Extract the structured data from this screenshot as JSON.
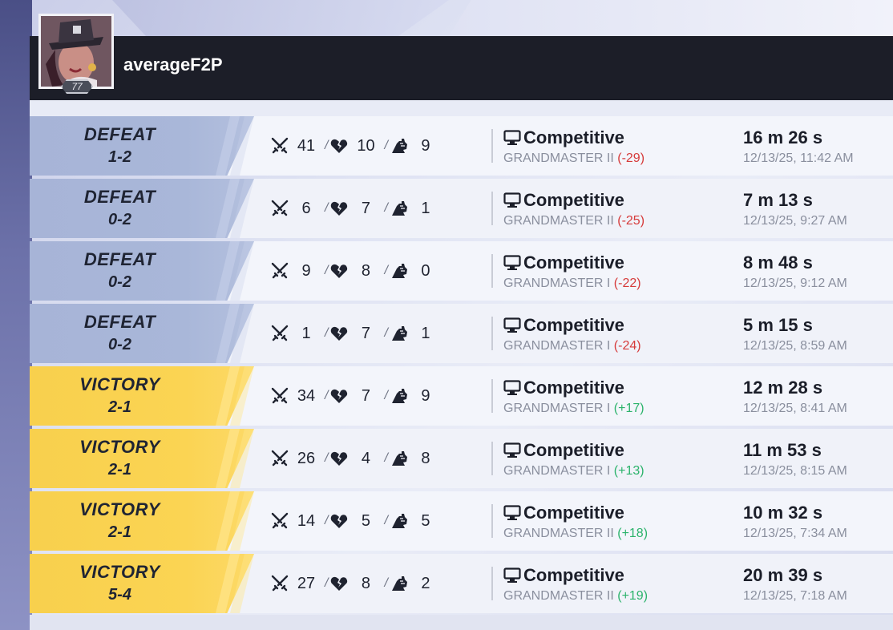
{
  "player": {
    "username": "averageF2P",
    "level": "77"
  },
  "colors": {
    "defeat": "#a9b7d9",
    "victory": "#fbd453",
    "rank_loss": "#d63a3a",
    "rank_gain": "#2bb36b",
    "header_bg": "#1c1e28"
  },
  "icons": {
    "eliminations": "crossed-swords-icon",
    "deaths": "broken-heart-icon",
    "assists": "raised-fist-icon",
    "mode": "monitor-icon"
  },
  "matches": [
    {
      "result": "DEFEAT",
      "outcome": "defeat",
      "score": "1-2",
      "kills": "41",
      "deaths": "10",
      "assists": "9",
      "mode": "Competitive",
      "rank": "GRANDMASTER II",
      "delta": "(-29)",
      "delta_sign": "neg",
      "duration": "16 m 26 s",
      "date": "12/13/25, 11:42 AM"
    },
    {
      "result": "DEFEAT",
      "outcome": "defeat",
      "score": "0-2",
      "kills": "6",
      "deaths": "7",
      "assists": "1",
      "mode": "Competitive",
      "rank": "GRANDMASTER II",
      "delta": "(-25)",
      "delta_sign": "neg",
      "duration": "7 m 13 s",
      "date": "12/13/25, 9:27 AM"
    },
    {
      "result": "DEFEAT",
      "outcome": "defeat",
      "score": "0-2",
      "kills": "9",
      "deaths": "8",
      "assists": "0",
      "mode": "Competitive",
      "rank": "GRANDMASTER I",
      "delta": "(-22)",
      "delta_sign": "neg",
      "duration": "8 m 48 s",
      "date": "12/13/25, 9:12 AM"
    },
    {
      "result": "DEFEAT",
      "outcome": "defeat",
      "score": "0-2",
      "kills": "1",
      "deaths": "7",
      "assists": "1",
      "mode": "Competitive",
      "rank": "GRANDMASTER I",
      "delta": "(-24)",
      "delta_sign": "neg",
      "duration": "5 m 15 s",
      "date": "12/13/25, 8:59 AM"
    },
    {
      "result": "VICTORY",
      "outcome": "victory",
      "score": "2-1",
      "kills": "34",
      "deaths": "7",
      "assists": "9",
      "mode": "Competitive",
      "rank": "GRANDMASTER I",
      "delta": "(+17)",
      "delta_sign": "pos",
      "duration": "12 m 28 s",
      "date": "12/13/25, 8:41 AM"
    },
    {
      "result": "VICTORY",
      "outcome": "victory",
      "score": "2-1",
      "kills": "26",
      "deaths": "4",
      "assists": "8",
      "mode": "Competitive",
      "rank": "GRANDMASTER I",
      "delta": "(+13)",
      "delta_sign": "pos",
      "duration": "11 m 53 s",
      "date": "12/13/25, 8:15 AM"
    },
    {
      "result": "VICTORY",
      "outcome": "victory",
      "score": "2-1",
      "kills": "14",
      "deaths": "5",
      "assists": "5",
      "mode": "Competitive",
      "rank": "GRANDMASTER II",
      "delta": "(+18)",
      "delta_sign": "pos",
      "duration": "10 m 32 s",
      "date": "12/13/25, 7:34 AM"
    },
    {
      "result": "VICTORY",
      "outcome": "victory",
      "score": "5-4",
      "kills": "27",
      "deaths": "8",
      "assists": "2",
      "mode": "Competitive",
      "rank": "GRANDMASTER II",
      "delta": "(+19)",
      "delta_sign": "pos",
      "duration": "20 m 39 s",
      "date": "12/13/25, 7:18 AM"
    }
  ]
}
